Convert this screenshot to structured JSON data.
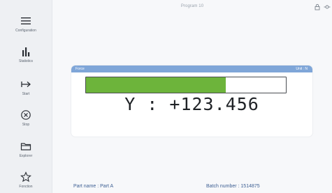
{
  "header": {
    "title": "Program 10"
  },
  "sidebar": {
    "items": [
      {
        "label": "Configuration",
        "icon": "menu-icon"
      },
      {
        "label": "Statistics",
        "icon": "bar-chart-icon"
      },
      {
        "label": "Start",
        "icon": "start-arrow-icon"
      },
      {
        "label": "Stop",
        "icon": "stop-circle-icon"
      },
      {
        "label": "Explorer",
        "icon": "folder-icon"
      },
      {
        "label": "Fonction",
        "icon": "star-icon"
      }
    ]
  },
  "gauge": {
    "header_left": "Force",
    "header_right": "Unit : N",
    "fill_fraction": 0.7,
    "reading": "Y : +123.456"
  },
  "footer": {
    "part_label": "Part name : Part A",
    "batch_label": "Batch number : 1514875"
  },
  "colors": {
    "accent": "#7fa6d8",
    "bar_fill": "#6db43b",
    "footer_text": "#3d5f93"
  }
}
